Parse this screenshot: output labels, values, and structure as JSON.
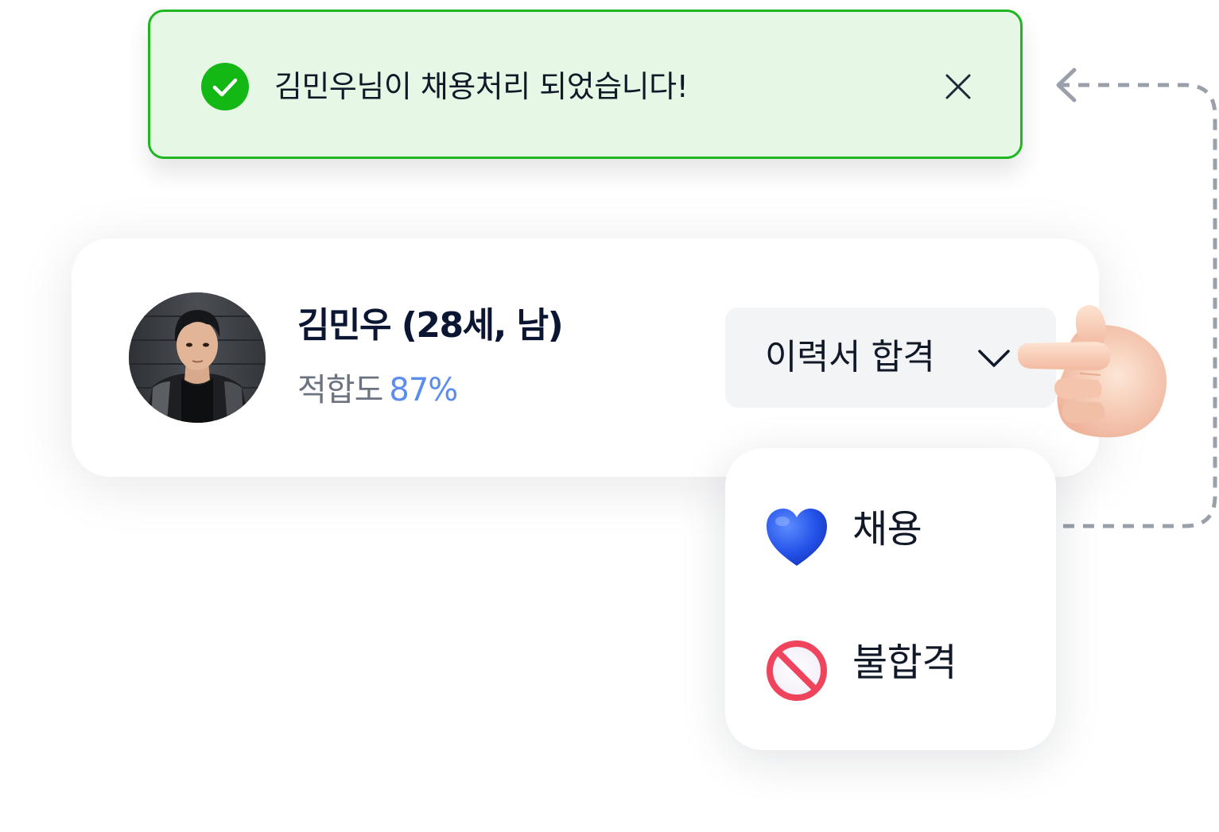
{
  "toast": {
    "message": "김민우님이 채용처리 되었습니다!",
    "icon": "check-circle-icon",
    "close_icon": "close-icon",
    "accent_color": "#14b814",
    "background_color": "#e6f7e6"
  },
  "candidate": {
    "name_line": "김민우 (28세, 남)",
    "fit_label": "적합도",
    "fit_value": "87%",
    "fit_percent": 87,
    "fit_color": "#5b8def"
  },
  "status": {
    "selected": "이력서 합격",
    "chevron_icon": "chevron-down-icon"
  },
  "menu": {
    "items": [
      {
        "label": "채용",
        "icon": "blue-heart-icon"
      },
      {
        "label": "불합격",
        "icon": "prohibited-icon"
      }
    ]
  },
  "decorations": {
    "hand_icon": "pointing-hand-icon",
    "connector": "dashed-arrow-connector"
  }
}
